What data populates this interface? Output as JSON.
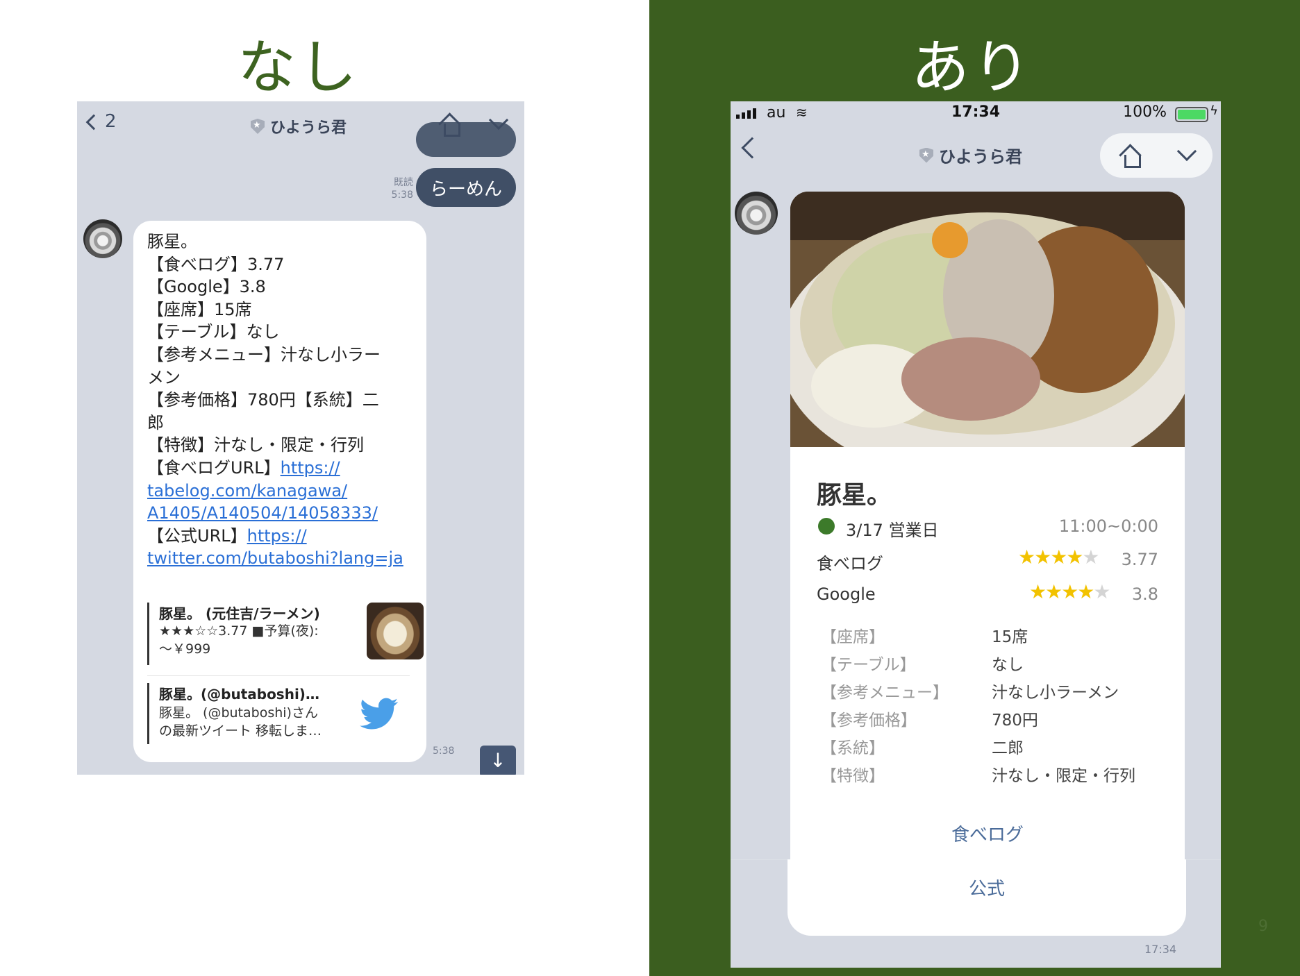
{
  "slide": {
    "left_title": "なし",
    "right_title": "あり",
    "page_number": "9",
    "colors": {
      "green": "#3b5e1f",
      "title_green": "#3d6320"
    }
  },
  "left": {
    "back_count": "2",
    "chat_title": "ひようら君",
    "ghost_text": "らーめん",
    "user_message": "らーめん",
    "read_label": "既読",
    "read_time": "5:38",
    "bot_lines": [
      "豚星。",
      "【食べログ】3.77",
      "【Google】3.8",
      "【座席】15席",
      "【テーブル】なし",
      "【参考メニュー】汁なし小ラー",
      "メン",
      "【参考価格】780円【系統】二",
      "郎",
      "【特徴】汁なし・限定・行列"
    ],
    "tabelog_label": "【食べログURL】",
    "tabelog_url_1": "https://",
    "tabelog_url_2": "tabelog.com/kanagawa/",
    "tabelog_url_3": "A1405/A140504/14058333/",
    "official_label": "【公式URL】",
    "official_url_1": "https://",
    "official_url_2": "twitter.com/butaboshi?lang=ja",
    "card1_title": "豚星。 (元住吉/ラーメン)",
    "card1_line1": "★★★☆☆3.77 ■予算(夜):",
    "card1_line2": "～￥999",
    "card2_title": "豚星。(@butaboshi)…",
    "card2_line1": "豚星。 (@butaboshi)さん",
    "card2_line2": "の最新ツイート 移転しま…",
    "msg_time": "5:38",
    "down_arrow": "↓"
  },
  "right": {
    "carrier": "au",
    "time": "17:34",
    "battery": "100%",
    "chat_title": "ひようら君",
    "shop_name": "豚星。",
    "open_day": "3/17 営業日",
    "hours": "11:00~0:00",
    "ratings": [
      {
        "label": "食べログ",
        "stars": 4,
        "value": "3.77"
      },
      {
        "label": "Google",
        "stars": 4,
        "value": "3.8"
      }
    ],
    "details": [
      {
        "key": "【座席】",
        "value": "15席"
      },
      {
        "key": "【テーブル】",
        "value": "なし"
      },
      {
        "key": "【参考メニュー】",
        "value": "汁なし小ラーメン"
      },
      {
        "key": "【参考価格】",
        "value": "780円"
      },
      {
        "key": "【系統】",
        "value": "二郎"
      },
      {
        "key": "【特徴】",
        "value": "汁なし・限定・行列"
      }
    ],
    "tabelog_button": "食べログ",
    "official_button": "公式",
    "msg_time": "17:34"
  }
}
